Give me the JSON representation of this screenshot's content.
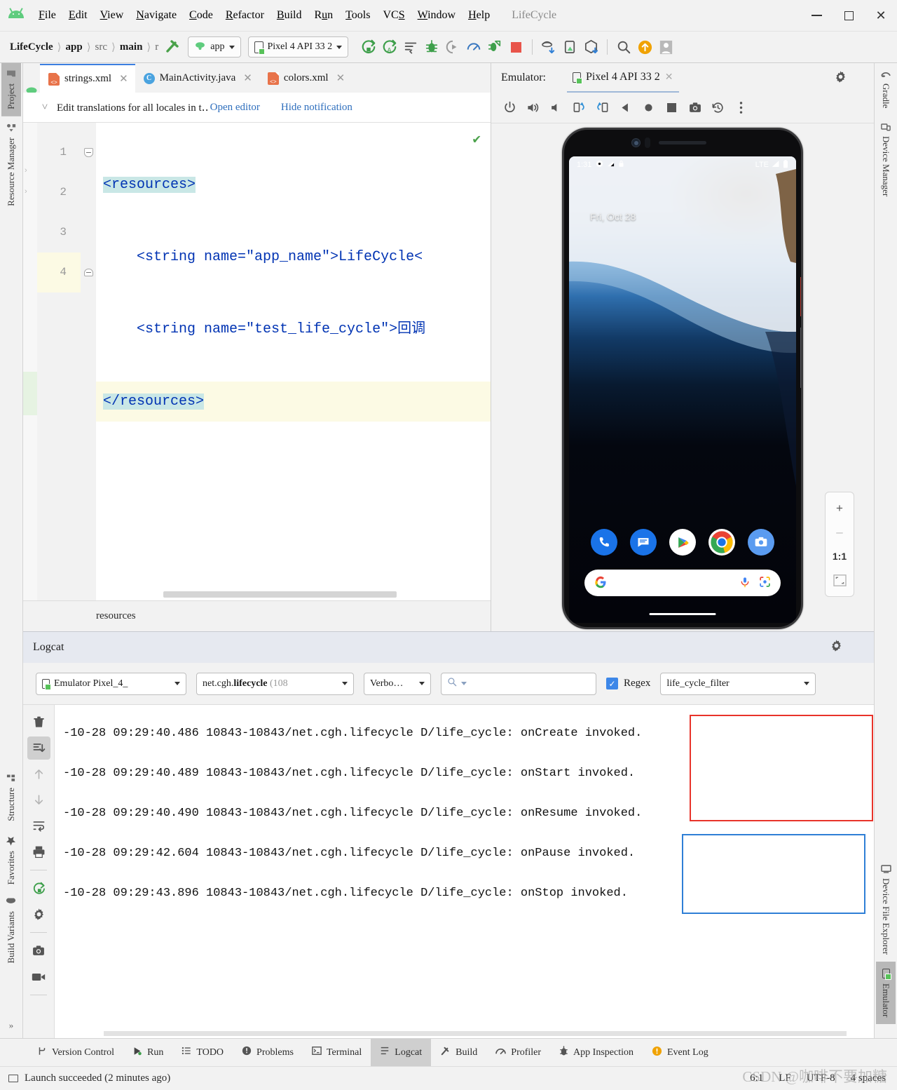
{
  "window": {
    "title": "LifeCycle",
    "minimize_label": "–",
    "maximize_label": "□",
    "close_label": "✕"
  },
  "menubar": {
    "items": [
      {
        "label": "File",
        "mnemonic": "F"
      },
      {
        "label": "Edit",
        "mnemonic": "E"
      },
      {
        "label": "View",
        "mnemonic": "V"
      },
      {
        "label": "Navigate",
        "mnemonic": "N"
      },
      {
        "label": "Code",
        "mnemonic": "C"
      },
      {
        "label": "Refactor",
        "mnemonic": "R"
      },
      {
        "label": "Build",
        "mnemonic": "B"
      },
      {
        "label": "Run",
        "mnemonic": "R"
      },
      {
        "label": "Tools",
        "mnemonic": "T"
      },
      {
        "label": "VCS",
        "mnemonic": "S"
      },
      {
        "label": "Window",
        "mnemonic": "W"
      },
      {
        "label": "Help",
        "mnemonic": "H"
      }
    ]
  },
  "toolbar": {
    "breadcrumbs": [
      "LifeCycle",
      "app",
      "src",
      "main",
      "r"
    ],
    "run_config": "app",
    "device": "Pixel 4 API 33 2",
    "icons": [
      "run-icon",
      "run-with-coverage-icon",
      "apply-changes-icon",
      "debug-icon",
      "attach-debugger-icon",
      "profiler-icon",
      "apply-code-changes-icon",
      "stop-icon",
      "sync-project-icon",
      "avd-manager-icon",
      "sdk-manager-icon",
      "search-everywhere-icon",
      "update-icon",
      "account-icon"
    ]
  },
  "left_rail": {
    "top": [
      {
        "label": "Project",
        "icon": "folder-icon",
        "active": true
      },
      {
        "label": "Resource Manager",
        "icon": "resource-icon",
        "active": false
      }
    ],
    "bottom": [
      {
        "label": "Structure",
        "icon": "structure-icon"
      },
      {
        "label": "Favorites",
        "icon": "star-icon"
      },
      {
        "label": "Build Variants",
        "icon": "android-icon"
      }
    ]
  },
  "right_rail": {
    "top": [
      {
        "label": "Gradle",
        "icon": "gradle-icon"
      },
      {
        "label": "Device Manager",
        "icon": "device-manager-icon"
      }
    ],
    "bottom": [
      {
        "label": "Device File Explorer",
        "icon": "device-file-explorer-icon"
      },
      {
        "label": "Emulator",
        "icon": "emulator-icon",
        "active": true
      }
    ]
  },
  "editor": {
    "tabs": [
      {
        "label": "strings.xml",
        "icon": "xml-file-icon",
        "active": true
      },
      {
        "label": "MainActivity.java",
        "icon": "java-class-icon",
        "active": false
      },
      {
        "label": "colors.xml",
        "icon": "xml-file-icon",
        "active": false
      }
    ],
    "notification": {
      "message": "Edit translations for all locales in t‥",
      "action_open": "Open editor",
      "action_hide": "Hide notification"
    },
    "lines": [
      {
        "number": "1",
        "text": "<resources>",
        "current": false
      },
      {
        "number": "2",
        "text": "    <string name=\"app_name\">LifeCycle<",
        "current": false
      },
      {
        "number": "3",
        "text": "    <string name=\"test_life_cycle\">回调",
        "current": false
      },
      {
        "number": "4",
        "text": "</resources>",
        "current": true
      }
    ],
    "breadcrumb": "resources",
    "inspection_status": "✔"
  },
  "emulator": {
    "panel_label": "Emulator:",
    "tab_label": "Pixel 4 API 33 2",
    "toolbar_icons": [
      "power-icon",
      "volume-up-icon",
      "volume-down-icon",
      "rotate-left-icon",
      "rotate-right-icon",
      "back-icon",
      "home-icon",
      "overview-icon",
      "screenshot-icon",
      "history-icon",
      "more-icon"
    ],
    "settings_icon": "gear-icon",
    "minimize_icon": "minimize-icon",
    "device": {
      "status_time": "1:31",
      "status_network": "LTE",
      "status_icons": [
        "gear-icon",
        "signal-warning-icon",
        "lock-icon",
        "signal-icon",
        "battery-icon"
      ],
      "home_date": "Fri, Oct 28",
      "dock_apps": [
        "phone-icon",
        "messages-icon",
        "play-store-icon",
        "chrome-icon",
        "camera-icon"
      ],
      "search_placeholder": "",
      "search_icons": [
        "google-g-icon",
        "mic-icon",
        "lens-icon"
      ]
    },
    "zoom_controls": [
      "+",
      "–",
      "1:1",
      "fit-icon"
    ]
  },
  "logcat": {
    "title": "Logcat",
    "settings_icon": "gear-icon",
    "minimize_icon": "minimize-icon",
    "filters": {
      "device": "Emulator Pixel_4_",
      "process_prefix": "net.cgh.",
      "process_bold": "lifecycle",
      "process_suffix": " (108",
      "level": "Verbo…",
      "search_placeholder": "",
      "search_icon": "search-icon",
      "regex_label": "Regex",
      "regex_checked": true,
      "filter_name": "life_cycle_filter"
    },
    "rail_icons": [
      "trash-icon",
      "scroll-to-end-icon",
      "up-arrow-icon",
      "down-arrow-icon",
      "soft-wrap-icon",
      "print-icon",
      "restart-icon",
      "settings-icon",
      "screenshot-icon",
      "record-icon"
    ],
    "entries": [
      {
        "prefix": "-10-28 09:29:40.486 10843-10843/net.cgh.lifecycle D/life_cycle: ",
        "message": "onCreate invoked.",
        "highlight": "red"
      },
      {
        "prefix": "-10-28 09:29:40.489 10843-10843/net.cgh.lifecycle D/life_cycle: ",
        "message": "onStart invoked.",
        "highlight": "red"
      },
      {
        "prefix": "-10-28 09:29:40.490 10843-10843/net.cgh.lifecycle D/life_cycle: ",
        "message": "onResume invoked.",
        "highlight": "red"
      },
      {
        "prefix": "-10-28 09:29:42.604 10843-10843/net.cgh.lifecycle D/life_cycle: ",
        "message": "onPause invoked.",
        "highlight": "blue"
      },
      {
        "prefix": "-10-28 09:29:43.896 10843-10843/net.cgh.lifecycle D/life_cycle: ",
        "message": "onStop invoked.",
        "highlight": "blue"
      }
    ],
    "annotation_colors": {
      "red": "#e8332a",
      "blue": "#2f7fd6"
    }
  },
  "bottom_tools": [
    {
      "label": "Version Control",
      "icon": "branch-icon",
      "active": false
    },
    {
      "label": "Run",
      "icon": "run-icon",
      "active": false
    },
    {
      "label": "TODO",
      "icon": "todo-icon",
      "active": false
    },
    {
      "label": "Problems",
      "icon": "problems-icon",
      "active": false
    },
    {
      "label": "Terminal",
      "icon": "terminal-icon",
      "active": false
    },
    {
      "label": "Logcat",
      "icon": "logcat-icon",
      "active": true
    },
    {
      "label": "Build",
      "icon": "build-icon",
      "active": false
    },
    {
      "label": "Profiler",
      "icon": "profiler-icon",
      "active": false
    },
    {
      "label": "App Inspection",
      "icon": "inspection-icon",
      "active": false
    },
    {
      "label": "Event Log",
      "icon": "event-log-icon",
      "active": false
    }
  ],
  "statusbar": {
    "message": "Launch succeeded (2 minutes ago)",
    "caret": "6:1",
    "line_separator": "LF",
    "encoding": "UTF-8",
    "indent": "4 spaces",
    "watermark": "CSDN @咖啡不要加糖"
  },
  "colors": {
    "accent_blue": "#3d87e8",
    "android_green": "#5fcc7e",
    "annotation_red": "#e8332a",
    "annotation_blue": "#2f7fd6",
    "code_tag": "#0033b3",
    "code_value": "#0b7c28",
    "selection": "#c9e7e6"
  }
}
